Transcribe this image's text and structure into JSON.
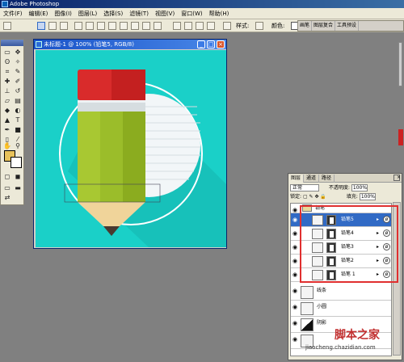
{
  "window": {
    "title": "Adobe Photoshop"
  },
  "menu": [
    "文件(F)",
    "编辑(E)",
    "图像(I)",
    "图层(L)",
    "选择(S)",
    "滤镜(T)",
    "视图(V)",
    "窗口(W)",
    "帮助(H)"
  ],
  "options_bar": {
    "style_label": "样式:",
    "color_label": "颜色:",
    "palette_tabs": [
      "画笔",
      "图层复合",
      "工具预设"
    ]
  },
  "document": {
    "title": "未标题-1 @ 100% (铅笔5, RGB/8)"
  },
  "layers_panel": {
    "tabs": [
      "图层",
      "通道",
      "路径"
    ],
    "blend_mode": "正常",
    "opacity_label": "不透明度:",
    "opacity": "100%",
    "lock_label": "锁定:",
    "fill_label": "填充:",
    "fill": "100%",
    "layers": [
      {
        "name": "铅笔",
        "kind": "group"
      },
      {
        "name": "铅笔5",
        "kind": "masked",
        "selected": true
      },
      {
        "name": "铅笔4",
        "kind": "masked"
      },
      {
        "name": "铅笔3",
        "kind": "masked"
      },
      {
        "name": "铅笔2",
        "kind": "masked"
      },
      {
        "name": "铅笔 1",
        "kind": "masked"
      },
      {
        "name": "线条",
        "kind": "plain"
      },
      {
        "name": "小圆",
        "kind": "plain"
      },
      {
        "name": "阴影",
        "kind": "plain"
      },
      {
        "name": "",
        "kind": "plain"
      }
    ]
  },
  "watermark": {
    "text": "脚本之家",
    "url": "jiaocheng.chazidian.com"
  },
  "colors": {
    "canvas_bg": "#1ad0c8",
    "pencil_eraser": "#d92b2b",
    "pencil_body": "#a8c832",
    "selection_highlight": "#e03030"
  }
}
